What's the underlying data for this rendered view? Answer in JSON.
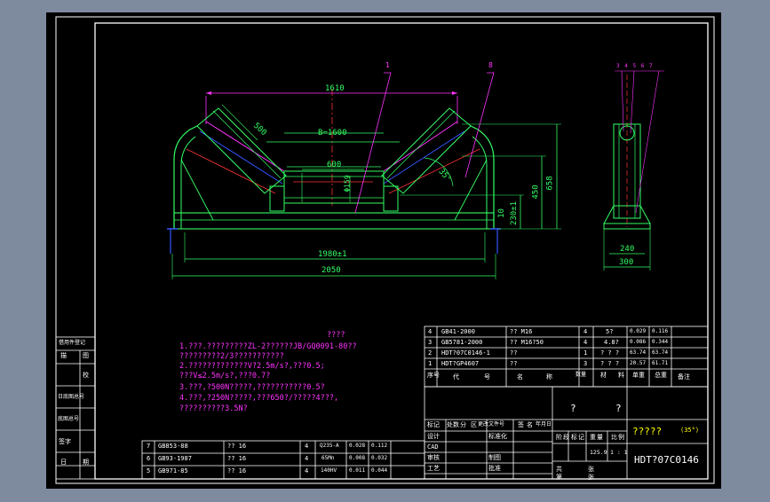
{
  "colors": {
    "background": "#7e8a9e",
    "sheet": "#000000",
    "border": "#ffffff",
    "dims": "#33ff66",
    "notes": "#ff33ff",
    "belt_outline": "#ff33ff",
    "center": "#ff3333",
    "blue": "#3355ff",
    "label": "#ffff00"
  },
  "drawing": {
    "dims_front": {
      "d1610": "1610",
      "d500": "500",
      "b1600": "B=1600",
      "d600": "600",
      "d159": "Φ159",
      "d35": "35°",
      "d450": "450",
      "d658": "658",
      "d10": "10",
      "d230": "230±1",
      "d1980": "1980±1",
      "d2050": "2050"
    },
    "dims_side": {
      "d240": "240",
      "d300": "300"
    },
    "balloons_front": [
      "1",
      "8"
    ],
    "balloons_side": [
      "3",
      "4",
      "5",
      "6",
      "7"
    ]
  },
  "notes": {
    "heading": "????",
    "lines": [
      "1.???.?????????ZL-2??????JB/GQ0091-80??",
      "  ?????????2/3???????????",
      "2.?????????????V?2.5m/s?,???0.5;",
      "  ???V≤2.5m/s?,???0.7?",
      "3.???,?500N?????,???????????0.5?",
      "4.???,?250N?????,???650?/?????4???,",
      "  ??????????3.5N?"
    ]
  },
  "left_strip": [
    "借用件登记",
    "描",
    "图",
    "校",
    "日底图总号",
    "底图总号",
    "签字",
    "日",
    "期"
  ],
  "bom_top": [
    {
      "no": "4",
      "code": "GB41-2000",
      "name": "?? M16",
      "qty": "4",
      "mat": "5?",
      "w1": "0.029",
      "w2": "0.116"
    },
    {
      "no": "3",
      "code": "GB5781-2000",
      "name": "?? M16?50",
      "qty": "4",
      "mat": "4.8?",
      "w1": "0.086",
      "w2": "0.344"
    },
    {
      "no": "2",
      "code": "HDT?07C0146-1",
      "name": "??",
      "qty": "1",
      "mat": "? ? ?",
      "w1": "63.74",
      "w2": "63.74"
    },
    {
      "no": "1",
      "code": "HDT?GP4607",
      "name": "??",
      "qty": "3",
      "mat": "? ? ?",
      "w1": "20.57",
      "w2": "61.71"
    }
  ],
  "bom_header": [
    "序号",
    "代",
    "号",
    "名",
    "称",
    "数量",
    "材",
    "料",
    "单重",
    "总重",
    "备注"
  ],
  "bom_bottom": [
    {
      "no": "7",
      "code": "GB853-88",
      "name": "??   16",
      "qty": "4",
      "mat": "Q235-A",
      "w1": "0.028",
      "w2": "0.112"
    },
    {
      "no": "6",
      "code": "GB93-1987",
      "name": "??   16",
      "qty": "4",
      "mat": "65Mn",
      "w1": "0.008",
      "w2": "0.032"
    },
    {
      "no": "5",
      "code": "GB971-85",
      "name": "??   16",
      "qty": "4",
      "mat": "140HV",
      "w1": "0.011",
      "w2": "0.044"
    }
  ],
  "title_block": {
    "q1": "?",
    "q2": "?",
    "labels": [
      "标记",
      "处数",
      "分",
      "区",
      "更改文件号",
      "签",
      "名",
      "年月日",
      "设计",
      "标准化",
      "CAD",
      "审核",
      "制图",
      "工艺",
      "批准",
      "阶",
      "段",
      "标",
      "记",
      "重",
      "量",
      "比",
      "例",
      "共",
      "张",
      "第",
      "张"
    ],
    "scale_weight": "125.9",
    "scale": "1 : 1",
    "name": "?????",
    "name_angle": "(35°)",
    "drawing_no": "HDT?07C0146"
  }
}
